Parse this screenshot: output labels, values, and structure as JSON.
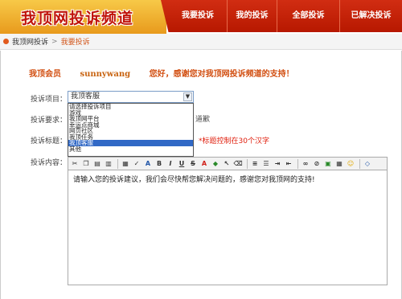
{
  "header": {
    "logo": "我顶网投诉频道",
    "nav": [
      "我要投诉",
      "我的投诉",
      "全部投诉",
      "已解决投诉"
    ]
  },
  "breadcrumb": {
    "home": "我顶网投诉",
    "separator": ">",
    "current": "我要投诉"
  },
  "greeting": {
    "prefix": "我顶会员",
    "username": "sunnywang",
    "message": "您好，感谢您对我顶网投诉频道的支持！"
  },
  "form": {
    "item_label": "投诉项目：",
    "item_value": "我顶客服",
    "item_options": [
      "请选择投诉项目",
      "游戏",
      "我顶网平台",
      "幸运点商城",
      "网页社区",
      "我顶任务",
      "我顶客服",
      "其他"
    ],
    "selected_index": 6,
    "requirement_label": "投诉要求：",
    "requirement_hint": "道歉",
    "title_label": "投诉标题：",
    "title_hint": "*标题控制在30个汉字",
    "content_label": "投诉内容：",
    "content_text": "请输入您的投诉建议，我们会尽快帮您解决问题的，感谢您对我顶网的支持!"
  },
  "colors": {
    "header_red": "#c01d05",
    "accent_orange": "#d24e10",
    "hint_red": "#e0200f",
    "selection_blue": "#3169c6"
  },
  "toolbar_icons": [
    "cut-icon",
    "copy-icon",
    "paste-icon",
    "paste-text-icon",
    "paste-word-icon",
    "spellcheck-icon",
    "font-icon",
    "bold-icon",
    "italic-icon",
    "underline-icon",
    "strike-icon",
    "font-color-icon",
    "bg-color-icon",
    "select-icon",
    "eraser-icon",
    "align-left-icon",
    "list-icon",
    "indent-icon",
    "outdent-icon",
    "link-icon",
    "unlink-icon",
    "image-icon",
    "flash-icon",
    "smiley-icon",
    "source-icon"
  ]
}
